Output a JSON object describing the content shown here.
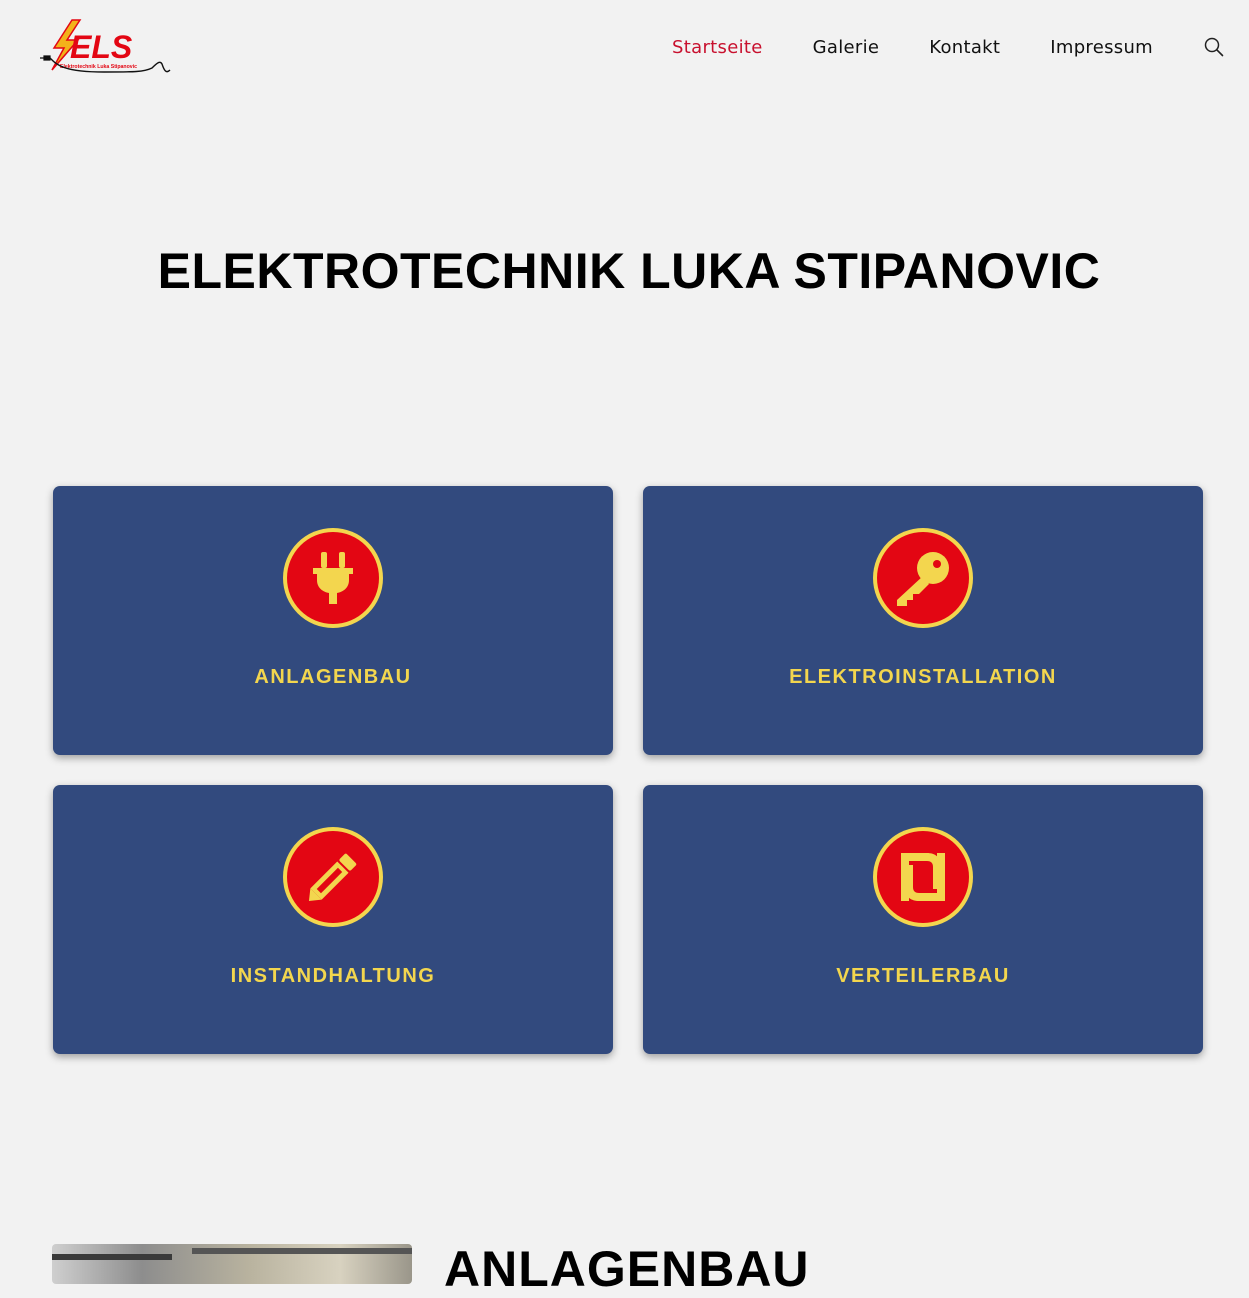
{
  "brand": {
    "logo_text": "ELS",
    "logo_subtext": "Elektrotechnik Luka Stipanovic",
    "red": "#e30613",
    "yellow": "#f3d64e"
  },
  "nav": {
    "items": [
      {
        "label": "Startseite",
        "active": true
      },
      {
        "label": "Galerie",
        "active": false
      },
      {
        "label": "Kontakt",
        "active": false
      },
      {
        "label": "Impressum",
        "active": false
      }
    ],
    "active_color": "#c8102e",
    "search_icon": "magnifier-icon"
  },
  "hero": {
    "title": "ELEKTROTECHNIK LUKA STIPANOVIC"
  },
  "services": {
    "card_color": "#324a7e",
    "label_color": "#f3d64e",
    "icon_ring_color": "#f3d64e",
    "icon_fill_color": "#e30613",
    "items": [
      {
        "label": "ANLAGENBAU",
        "icon": "plug-icon"
      },
      {
        "label": "ELEKTROINSTALLATION",
        "icon": "key-icon"
      },
      {
        "label": "INSTANDHALTUNG",
        "icon": "pencil-icon"
      },
      {
        "label": "VERTEILERBAU",
        "icon": "shekel-icon"
      }
    ]
  },
  "section": {
    "heading": "ANLAGENBAU"
  }
}
